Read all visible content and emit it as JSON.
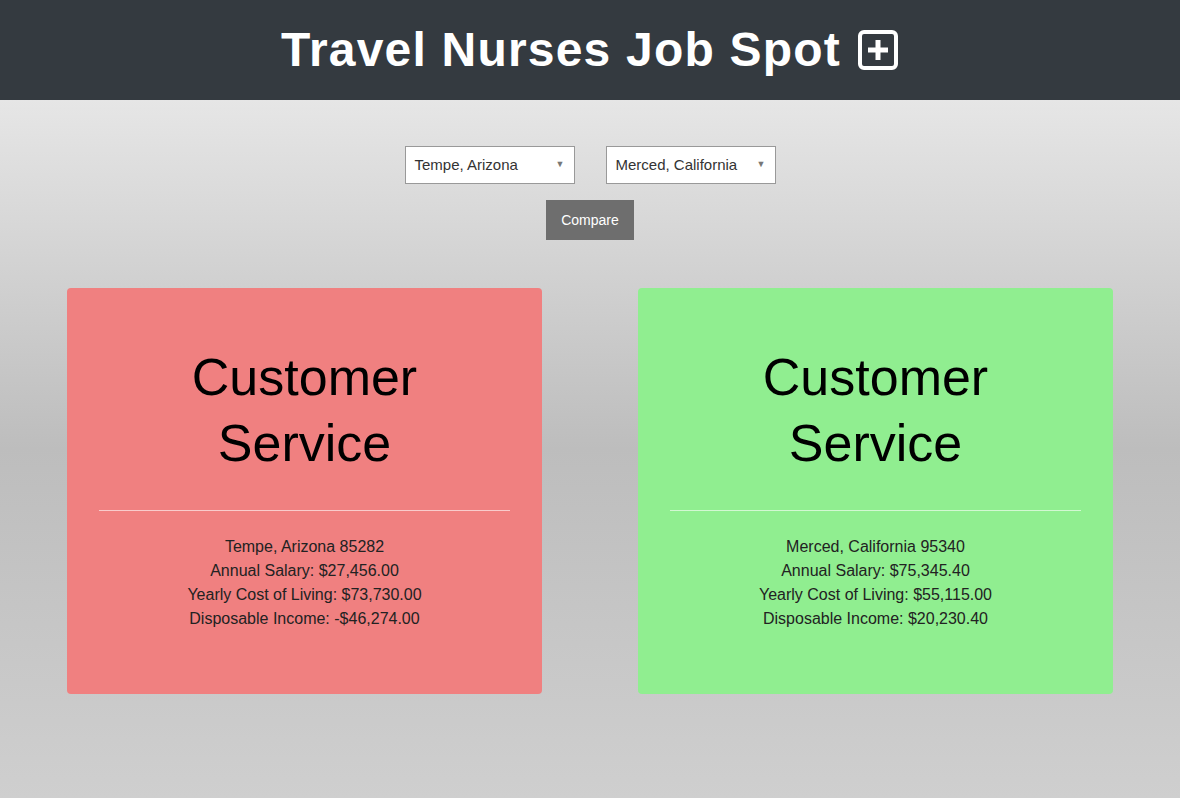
{
  "header": {
    "title": "Travel Nurses Job Spot"
  },
  "selects": [
    {
      "value": "Tempe, Arizona",
      "arrow": "▼"
    },
    {
      "value": "Merced, California",
      "arrow": "▼"
    }
  ],
  "compare_button": "Compare",
  "cards": [
    {
      "title": "Customer Service",
      "color": "#f08080",
      "lines": [
        "Tempe, Arizona 85282",
        "Annual Salary: $27,456.00",
        "Yearly Cost of Living: $73,730.00",
        "Disposable Income: -$46,274.00"
      ]
    },
    {
      "title": "Customer Service",
      "color": "#90ee90",
      "lines": [
        "Merced, California 95340",
        "Annual Salary: $75,345.40",
        "Yearly Cost of Living: $55,115.00",
        "Disposable Income: $20,230.40"
      ]
    }
  ]
}
